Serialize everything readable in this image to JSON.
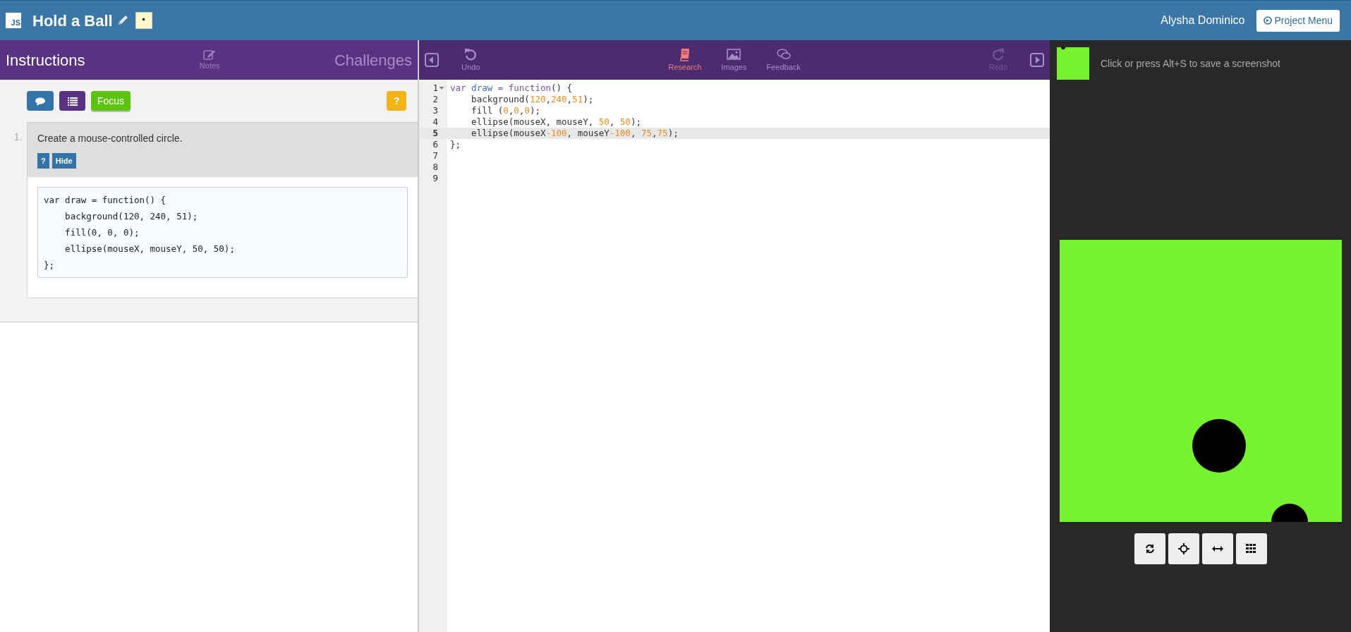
{
  "header": {
    "logo": "JS",
    "title": "Hold a Ball",
    "user": "Alysha Dominico",
    "project_menu": "Project Menu"
  },
  "left_tabs": [
    {
      "label": "Instructions",
      "selected": true,
      "kind": "text"
    },
    {
      "label": "Notes",
      "selected": false,
      "kind": "icon"
    },
    {
      "label": "Challenges",
      "selected": false,
      "kind": "text"
    }
  ],
  "instruction_toolbar": {
    "focus": "Focus",
    "help": "?"
  },
  "step": {
    "number": "1.",
    "text": "Create a mouse-controlled circle.",
    "buttons": [
      "?",
      "Hide"
    ],
    "code": [
      "var draw = function() {",
      "    background(120, 240, 51);",
      "    fill(0, 0, 0);",
      "    ellipse(mouseX, mouseY, 50, 50);",
      "};"
    ]
  },
  "editor_toolbar": {
    "undo": {
      "label": "Undo",
      "disabled": false
    },
    "redo": {
      "label": "Redo",
      "disabled": true
    },
    "tabs": [
      {
        "label": "Research",
        "selected": true
      },
      {
        "label": "Images",
        "selected": false
      },
      {
        "label": "Feedback",
        "selected": false
      }
    ]
  },
  "editor": {
    "lines": [
      {
        "number": "1",
        "fold": true,
        "active": false,
        "tokens": [
          {
            "text": "var ",
            "kind": "keyword"
          },
          {
            "text": "draw",
            "kind": "variable"
          },
          {
            "text": " = ",
            "kind": "keyword"
          },
          {
            "text": "function",
            "kind": "keyword"
          },
          {
            "text": "() {",
            "kind": "plain"
          }
        ]
      },
      {
        "number": "2",
        "fold": false,
        "active": false,
        "tokens": [
          {
            "text": "    background(",
            "kind": "plain"
          },
          {
            "text": "120",
            "kind": "number"
          },
          {
            "text": ",",
            "kind": "plain"
          },
          {
            "text": "240",
            "kind": "number"
          },
          {
            "text": ",",
            "kind": "plain"
          },
          {
            "text": "51",
            "kind": "number"
          },
          {
            "text": ");",
            "kind": "plain"
          }
        ]
      },
      {
        "number": "3",
        "fold": false,
        "active": false,
        "tokens": [
          {
            "text": "    fill (",
            "kind": "plain"
          },
          {
            "text": "0",
            "kind": "number"
          },
          {
            "text": ",",
            "kind": "plain"
          },
          {
            "text": "0",
            "kind": "number"
          },
          {
            "text": ",",
            "kind": "plain"
          },
          {
            "text": "0",
            "kind": "number"
          },
          {
            "text": ");",
            "kind": "plain"
          }
        ]
      },
      {
        "number": "4",
        "fold": false,
        "active": false,
        "tokens": [
          {
            "text": "    ellipse(mouseX, mouseY, ",
            "kind": "plain"
          },
          {
            "text": "50",
            "kind": "number"
          },
          {
            "text": ", ",
            "kind": "plain"
          },
          {
            "text": "50",
            "kind": "number"
          },
          {
            "text": ");",
            "kind": "plain"
          }
        ]
      },
      {
        "number": "5",
        "fold": false,
        "active": true,
        "tokens": [
          {
            "text": "    ellipse(mouseX",
            "kind": "plain"
          },
          {
            "text": "-100",
            "kind": "number"
          },
          {
            "text": ", mouseY",
            "kind": "plain"
          },
          {
            "text": "-100",
            "kind": "number"
          },
          {
            "text": ", ",
            "kind": "plain"
          },
          {
            "text": "75",
            "kind": "number"
          },
          {
            "text": ",",
            "kind": "plain"
          },
          {
            "text": "75",
            "kind": "number"
          },
          {
            "text": ");",
            "kind": "plain"
          }
        ]
      },
      {
        "number": "6",
        "fold": false,
        "active": false,
        "tokens": [
          {
            "text": "};",
            "kind": "plain"
          }
        ]
      },
      {
        "number": "7",
        "fold": false,
        "active": false
      },
      {
        "number": "8",
        "fold": false,
        "active": false
      },
      {
        "number": "9",
        "fold": false,
        "active": false
      }
    ]
  },
  "preview": {
    "screenshot_hint": "Click or press Alt+S to save a screenshot"
  }
}
